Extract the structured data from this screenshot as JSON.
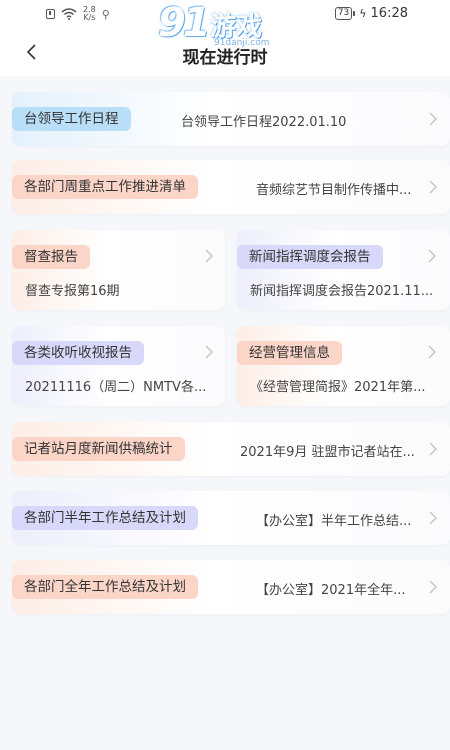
{
  "status_bar": {
    "speed_value": "2.8",
    "speed_unit": "K/s",
    "battery": "73",
    "time": "16:28"
  },
  "watermark": {
    "num": "91",
    "text": "游戏",
    "url": "91danji.com"
  },
  "header": {
    "title": "现在进行时"
  },
  "cards": [
    {
      "tag": "台领导工作日程",
      "desc": "台领导工作日程2022.01.10"
    },
    {
      "tag": "各部门周重点工作推进清单",
      "desc": "音频综艺节目制作传播中..."
    },
    {
      "tag": "督查报告",
      "desc": "督查专报第16期"
    },
    {
      "tag": "新闻指挥调度会报告",
      "desc": "新闻指挥调度会报告2021.11..."
    },
    {
      "tag": "各类收听收视报告",
      "desc": "20211116（周二）NMTV各..."
    },
    {
      "tag": "经营管理信息",
      "desc": "《经营管理简报》2021年第..."
    },
    {
      "tag": "记者站月度新闻供稿统计",
      "desc": "2021年9月 驻盟市记者站在..."
    },
    {
      "tag": "各部门半年工作总结及计划",
      "desc": "【办公室】半年工作总结..."
    },
    {
      "tag": "各部门全年工作总结及计划",
      "desc": "【办公室】2021年全年..."
    }
  ],
  "colors": {
    "blue_tag": "#b9def7",
    "orange_tag": "#fbd6c8",
    "purple_tag": "#d8d8fa"
  }
}
